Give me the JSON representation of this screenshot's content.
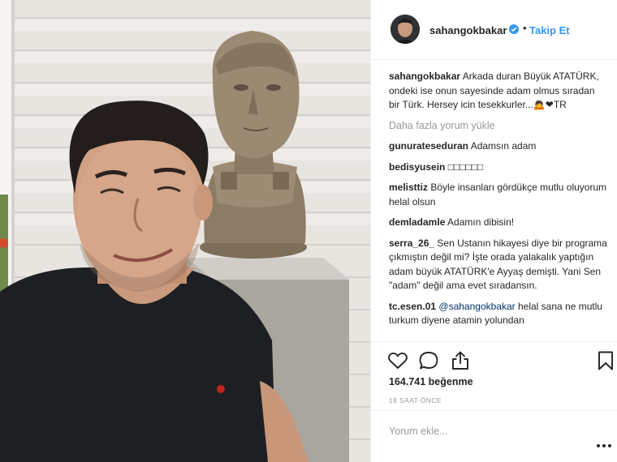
{
  "post": {
    "username": "sahangokbakar",
    "follow_label": "Takip Et",
    "dot": "•"
  },
  "caption": {
    "user": "sahangokbakar",
    "text": "Arkada duran Büyük ATATÜRK, ondeki ise onun sayesinde adam olmus sıradan bir Türk. Hersey icin tesekkurler...🙇❤TR"
  },
  "load_more_label": "Daha fazla yorum yükle",
  "comments": [
    {
      "user": "gunurateseduran",
      "text": "Adamsın adam"
    },
    {
      "user": "bedisyusein",
      "text": "□□□□□□"
    },
    {
      "user": "melisttiz",
      "text": "Böyle insanları gördükçe mutlu oluyorum helal olsun"
    },
    {
      "user": "demladamle",
      "text": "Adamın dibisin!"
    },
    {
      "user": "serra_26_",
      "text": "Sen Ustanın hikayesi diye bir programa çıkmıştın değil mi? İşte orada yalakalık yaptığın adam büyük ATATÜRK'e Ayyaş demişti. Yani Sen \"adam\" değil ama evet sıradansın."
    },
    {
      "user": "tc.esen.01",
      "mention": "@sahangokbakar",
      "text": "helal sana ne mutlu turkum diyene atamin yolundan"
    }
  ],
  "likes": "164.741 beğenme",
  "timestamp": "18 SAAT ÖNCE",
  "add_comment_placeholder": "Yorum ekle...",
  "icons": {
    "like": "heart-icon",
    "comment": "comment-icon",
    "share": "share-icon",
    "save": "bookmark-icon",
    "verified": "verified-badge-icon",
    "more": "more-options-icon"
  },
  "colors": {
    "link_blue": "#3897f0",
    "mention_blue": "#003569",
    "muted_gray": "#999999",
    "text": "#262626",
    "divider": "#efefef"
  }
}
